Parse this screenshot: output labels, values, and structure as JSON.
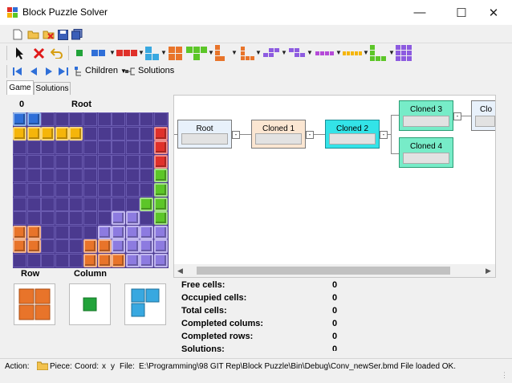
{
  "window": {
    "title": "Block Puzzle Solver"
  },
  "toolbar2": {
    "children_label": "Children",
    "solutions_label": "Solutions"
  },
  "tabs": [
    {
      "label": "Game"
    },
    {
      "label": "Solutions"
    }
  ],
  "board": {
    "depth_label": "0",
    "node_label": "Root"
  },
  "previews": {
    "row_label": "Row",
    "column_label": "Column"
  },
  "tree": {
    "nodes": [
      {
        "label": "Root",
        "color": "#e8f1fb"
      },
      {
        "label": "Cloned 1",
        "color": "#fbe6d2"
      },
      {
        "label": "Cloned 2",
        "color": "#33e3e8"
      },
      {
        "label": "Cloned 3",
        "color": "#77ecc8"
      },
      {
        "label": "Cloned 4",
        "color": "#77ecc8"
      },
      {
        "label": "Clo",
        "color": "#e8f1fb"
      }
    ]
  },
  "stats": [
    {
      "label": "Free cells:",
      "value": "0"
    },
    {
      "label": "Occupied cells:",
      "value": "0"
    },
    {
      "label": "Total cells:",
      "value": "0"
    },
    {
      "label": "Completed colums:",
      "value": "0"
    },
    {
      "label": "Completed rows:",
      "value": "0"
    },
    {
      "label": "Solutions:",
      "value": "0"
    }
  ],
  "status": {
    "action_label": "Action:",
    "piece_label": "Piece:",
    "coord_label": "Coord:",
    "coord_x": "x",
    "coord_y": "y",
    "file_label": "File:",
    "message": "E:\\Programming\\98 GIT Rep\\Block Puzzle\\Bin\\Debug\\Conv_newSer.bmd File loaded OK."
  },
  "colors": {
    "board": "#4b3a8f",
    "blue": "#2f6fd8",
    "yellow": "#f5b50a",
    "red": "#e0302a",
    "green": "#5cc628",
    "purple": "#8d7be0",
    "orange": "#e8742a"
  }
}
